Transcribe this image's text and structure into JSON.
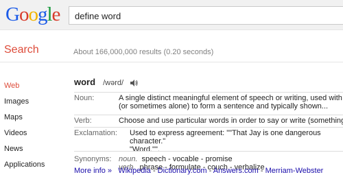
{
  "logo": {
    "text": "Google"
  },
  "search": {
    "query": "define word"
  },
  "bar": {
    "label": "Search",
    "results": "About 166,000,000 results (0.20 seconds)"
  },
  "nav": [
    {
      "label": "Web",
      "active": true
    },
    {
      "label": "Images"
    },
    {
      "label": "Maps"
    },
    {
      "label": "Videos"
    },
    {
      "label": "News"
    },
    {
      "label": "Applications"
    }
  ],
  "definition": {
    "word": "word",
    "pronunciation": "/wərd/",
    "noun": {
      "label": "Noun:",
      "line1": "A single distinct meaningful element of speech or writing, used with others",
      "line2": "(or sometimes alone) to form a sentence and typically shown..."
    },
    "verb": {
      "label": "Verb:",
      "text": "Choose and use particular words in order to say or write (something)."
    },
    "exclamation": {
      "label": "Exclamation:",
      "line1": "Used to express agreement: \"\"That Jay is one dangerous character.\"",
      "line2": "\"Word.\"\"."
    },
    "synonyms": {
      "label": "Synonyms:",
      "noun_pos": "noun.",
      "noun_list": "speech - vocable - promise",
      "verb_pos": "verb.",
      "verb_list": "phrase - formulate - couch - verbalize"
    }
  },
  "links": {
    "more": "More info »",
    "wikipedia": "Wikipedia",
    "dictionary": "Dictionary.com",
    "answers": "Answers.com",
    "mw": "Merriam-Webster",
    "sep": " - "
  }
}
